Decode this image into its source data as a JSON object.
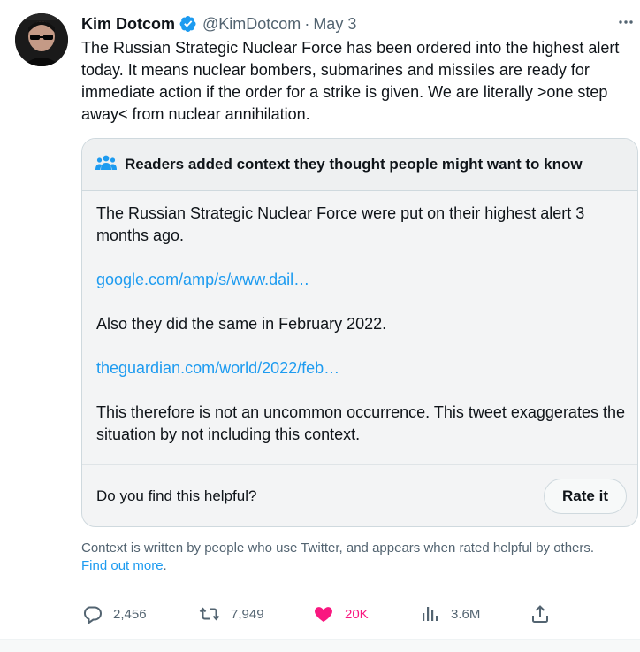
{
  "author": {
    "name": "Kim Dotcom",
    "handle": "@KimDotcom",
    "separator": "·",
    "date": "May 3",
    "verified_color": "#1d9bf0"
  },
  "tweet": {
    "text": "The Russian Strategic Nuclear Force has been ordered into the highest alert today. It means nuclear bombers, submarines and missiles are ready for immediate action if the order for a strike is given. We are literally >one step away< from nuclear annihilation."
  },
  "community_note": {
    "title": "Readers added context they thought people might want to know",
    "paragraphs": {
      "p1": "The Russian Strategic Nuclear Force were put on their highest alert 3 months ago.",
      "link1": "google.com/amp/s/www.dail…",
      "p2": "Also they did the same in February 2022.",
      "link2": "theguardian.com/world/2022/feb…",
      "p3": "This therefore is not an uncommon occurrence. This tweet exaggerates the situation by not including this context."
    },
    "helpful_question": "Do you find this helpful?",
    "rate_button": "Rate it"
  },
  "context_info": {
    "text": "Context is written by people who use Twitter, and appears when rated helpful by others.",
    "link": "Find out more",
    "suffix": "."
  },
  "actions": {
    "replies": "2,456",
    "retweets": "7,949",
    "likes": "20K",
    "views": "3.6M"
  },
  "colors": {
    "accent": "#1d9bf0",
    "like": "#f91880",
    "muted": "#536471"
  },
  "icons": [
    "verified-badge-icon",
    "more-icon",
    "people-icon",
    "reply-icon",
    "retweet-icon",
    "heart-icon",
    "views-icon",
    "share-icon"
  ]
}
